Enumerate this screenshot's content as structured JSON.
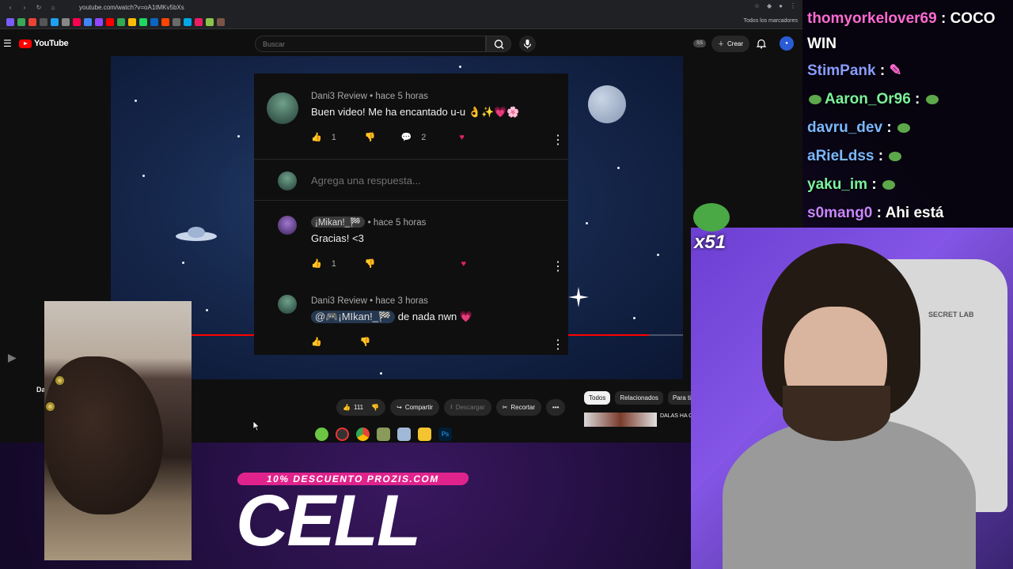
{
  "browser": {
    "url": "youtube.com/watch?v=oA1tMKv5bXs",
    "bookmarks_all": "Todos los marcadores"
  },
  "youtube": {
    "logo": "YouTube",
    "search_placeholder": "Buscar",
    "create_label": "Crear",
    "ss_badge": "SS"
  },
  "comments": [
    {
      "author": "Dani3 Review",
      "time": "• hace 5 horas",
      "text": "Buen video! Me ha encantado u-u 👌✨💗🌸",
      "likes": "1",
      "replies": "2"
    },
    {
      "reply_placeholder": "Agrega una respuesta..."
    },
    {
      "author": "¡Mikan!_🏁",
      "time": "• hace 5 horas",
      "text": "Gracias! <3",
      "likes": "1"
    },
    {
      "author": "Dani3 Review",
      "time": "• hace 3 horas",
      "mention": "@🎮¡MIkan!_🏁",
      "text": "de nada nwn 💗"
    }
  ],
  "actions": {
    "likes": "111",
    "share": "Compartir",
    "download": "Descargar",
    "clip": "Recortar"
  },
  "chips": [
    "Todos",
    "Relacionados",
    "Para ti"
  ],
  "side_video_title": "DALAS HA C",
  "left_label": "Da",
  "chat": [
    {
      "user": "thomyorkelover69",
      "msg": "COCO WIN",
      "color": "#ff6ad5"
    },
    {
      "user": "StimPank",
      "msg": "",
      "color": "#8a9cff"
    },
    {
      "user": "Aaron_Or96",
      "msg": "",
      "color": "#7cf29a"
    },
    {
      "user": "davru_dev",
      "msg": "",
      "color": "#7ab8ff"
    },
    {
      "user": "aRieLdss",
      "msg": "",
      "color": "#7ab8ff"
    },
    {
      "user": "yaku_im",
      "msg": "",
      "color": "#7cf29a"
    },
    {
      "user": "s0mang0",
      "msg": "Ahi está",
      "color": "#c886ff"
    }
  ],
  "emote_count": "x51",
  "sponsor": {
    "tagline": "10% DESCUENTO PROZIS.COM",
    "code": "CELL"
  },
  "streamer_chair_brand": "SECRET LAB"
}
